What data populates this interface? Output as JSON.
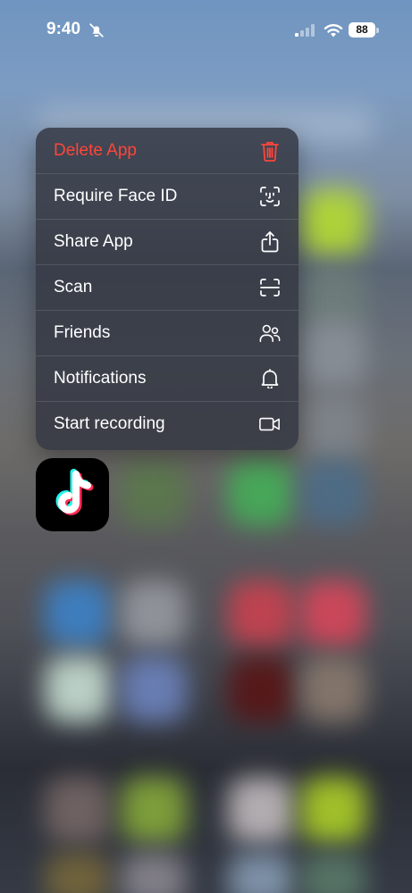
{
  "status_bar": {
    "time": "9:40",
    "battery": "88",
    "icons": [
      "bell-slash-icon",
      "cellular-signal-icon",
      "wifi-icon",
      "battery-icon"
    ]
  },
  "context_menu": {
    "items": [
      {
        "label": "Delete App",
        "icon": "trash-icon",
        "destructive": true
      },
      {
        "label": "Require Face ID",
        "icon": "face-id-icon"
      },
      {
        "label": "Share App",
        "icon": "share-icon"
      },
      {
        "label": "Scan",
        "icon": "scan-icon"
      },
      {
        "label": "Friends",
        "icon": "friends-icon"
      },
      {
        "label": "Notifications",
        "icon": "bell-icon"
      },
      {
        "label": "Start recording",
        "icon": "video-camera-icon"
      }
    ]
  },
  "app": {
    "icon": "tiktok-logo-icon"
  },
  "colors": {
    "destructive": "#ff453a",
    "menu_text": "#ffffff",
    "menu_background": "#343842"
  }
}
